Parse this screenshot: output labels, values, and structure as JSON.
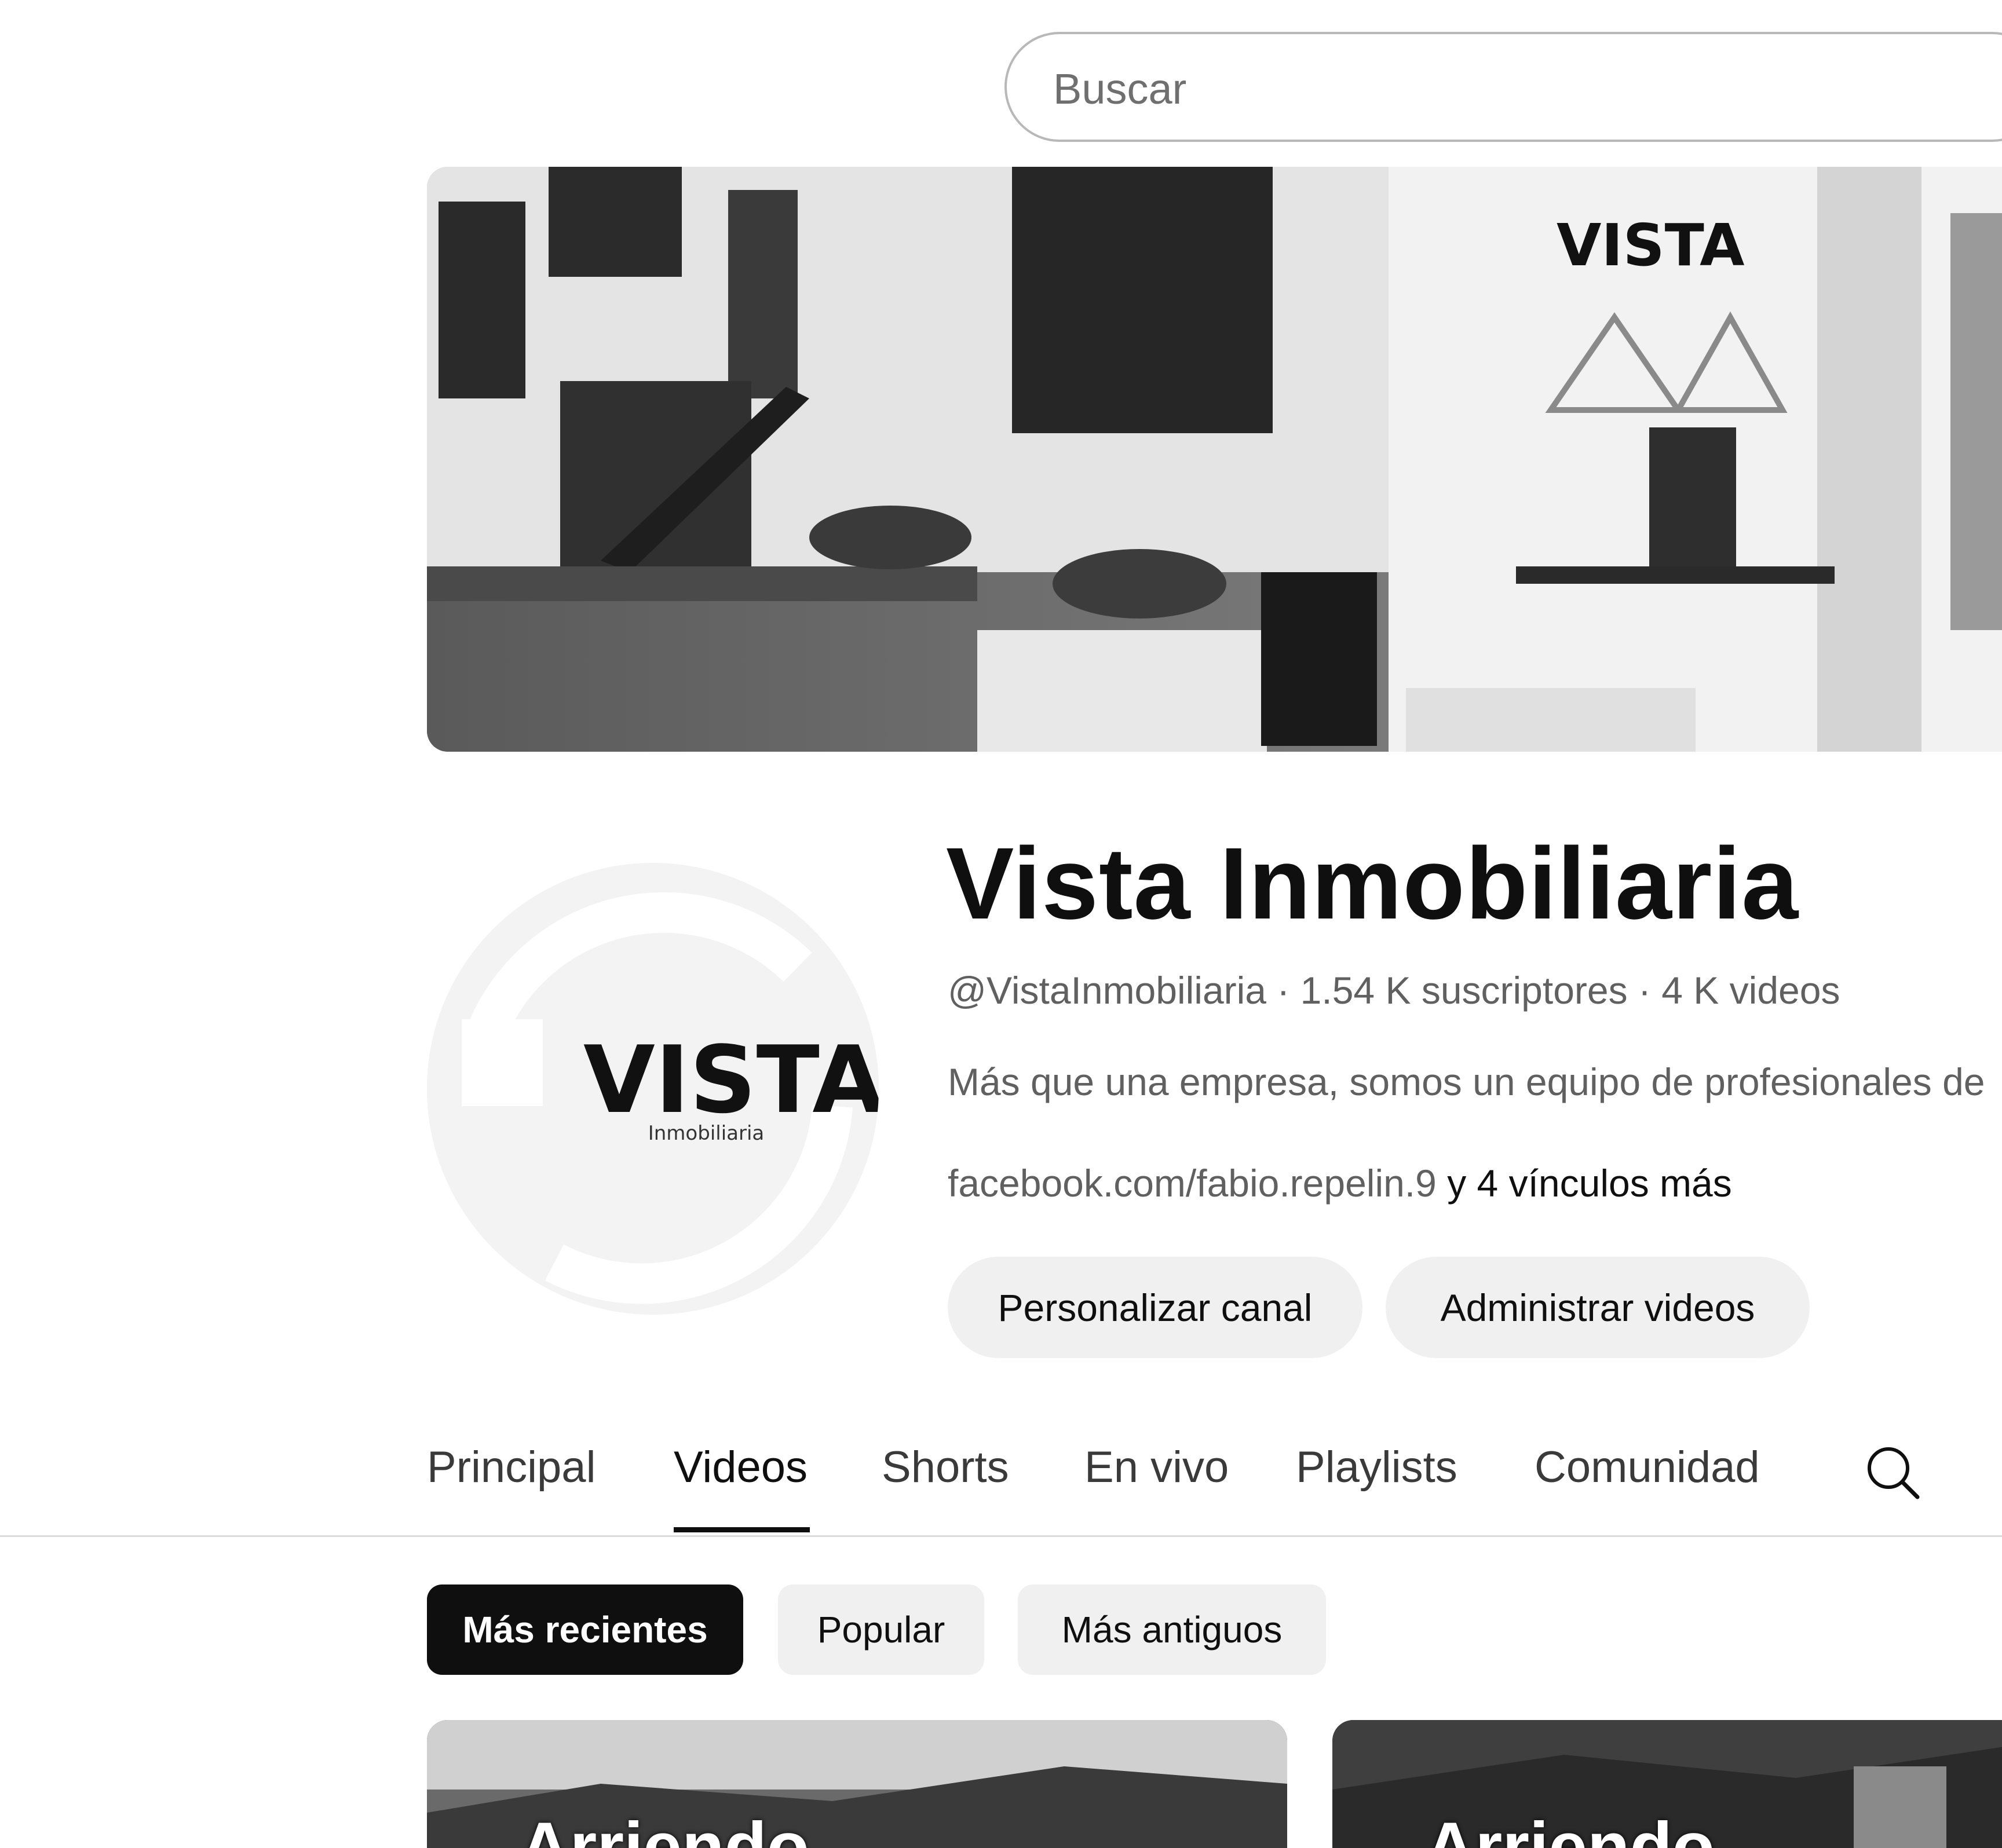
{
  "search": {
    "placeholder": "Buscar"
  },
  "banner": {
    "logo_text": "VISTA"
  },
  "channel": {
    "avatar_logo_text": "VISTA",
    "avatar_logo_subtext": "Inmobiliaria",
    "name": "Vista Inmobiliaria",
    "handle": "@VistaInmobiliaria",
    "subscribers": "1.54 K suscriptores",
    "videos": "4 K videos",
    "separator": " · ",
    "description": "Más que una empresa, somos un equipo de profesionales de",
    "link_primary": "facebook.com/fabio.repelin.9",
    "link_more": "y 4 vínculos más",
    "customize_label": "Personalizar canal",
    "manage_label": "Administrar videos"
  },
  "tabs": [
    {
      "label": "Principal",
      "active": false
    },
    {
      "label": "Videos",
      "active": true
    },
    {
      "label": "Shorts",
      "active": false
    },
    {
      "label": "En vivo",
      "active": false
    },
    {
      "label": "Playlists",
      "active": false
    },
    {
      "label": "Comunidad",
      "active": false
    }
  ],
  "filters": [
    {
      "label": "Más recientes",
      "selected": true
    },
    {
      "label": "Popular",
      "selected": false
    },
    {
      "label": "Más antiguos",
      "selected": false
    }
  ],
  "videos": [
    {
      "title": "Arriendo"
    },
    {
      "title": "Arriendo"
    }
  ],
  "icons": {
    "tab_search": "search-icon"
  },
  "colors": {
    "text_primary": "#0f0f0f",
    "text_secondary": "#606060",
    "chip_bg": "#f0f0f0",
    "chip_selected_bg": "#0f0f0f"
  }
}
